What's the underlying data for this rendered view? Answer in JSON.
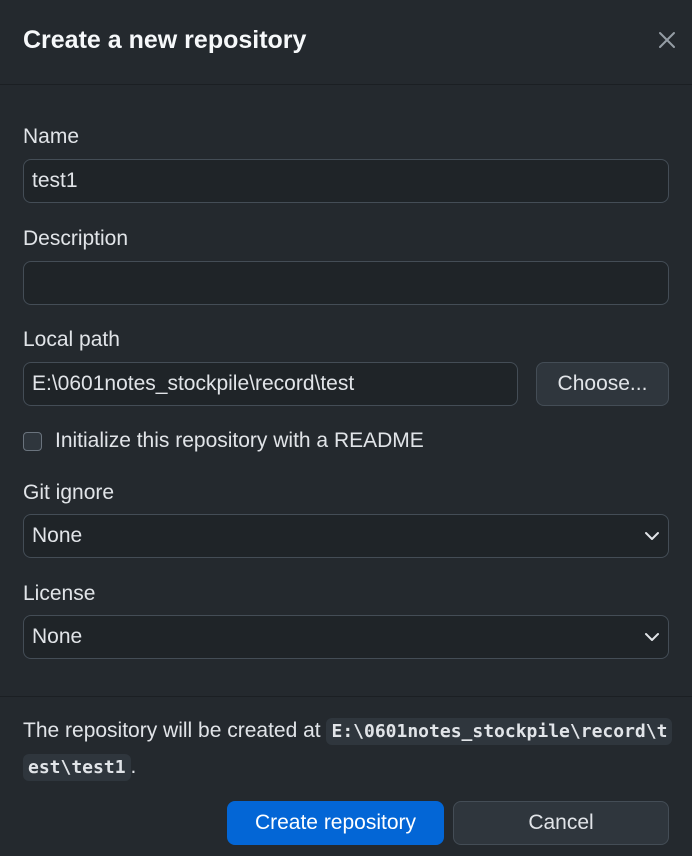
{
  "dialog": {
    "title": "Create a new repository"
  },
  "form": {
    "name": {
      "label": "Name",
      "value": "test1"
    },
    "description": {
      "label": "Description",
      "value": ""
    },
    "local_path": {
      "label": "Local path",
      "value": "E:\\0601notes_stockpile\\record\\test",
      "choose_label": "Choose..."
    },
    "readme": {
      "label": "Initialize this repository with a README",
      "checked": false
    },
    "git_ignore": {
      "label": "Git ignore",
      "selected": "None"
    },
    "license": {
      "label": "License",
      "selected": "None"
    }
  },
  "footer": {
    "message_prefix": "The repository will be created at",
    "path": "E:\\0601notes_stockpile\\record\\test\\test1",
    "message_suffix": ".",
    "create_label": "Create repository",
    "cancel_label": "Cancel"
  },
  "colors": {
    "background": "#24292e",
    "primary_button": "#0366d6",
    "input_background": "#1f2428",
    "border": "#444d56"
  }
}
